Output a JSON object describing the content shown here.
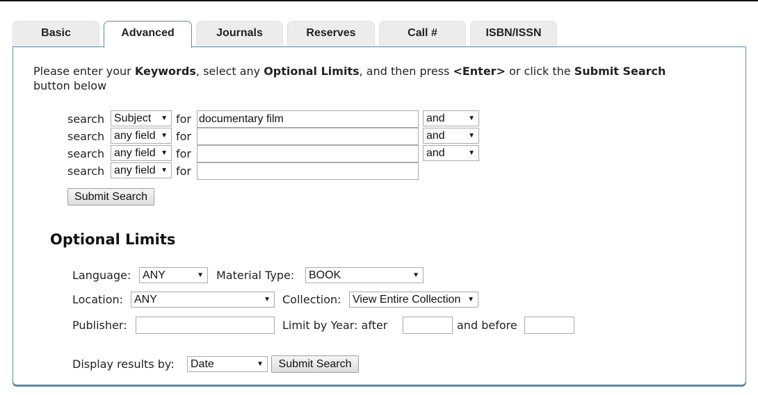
{
  "tabs": [
    {
      "label": "Basic"
    },
    {
      "label": "Advanced"
    },
    {
      "label": "Journals"
    },
    {
      "label": "Reserves"
    },
    {
      "label": "Call #"
    },
    {
      "label": "ISBN/ISSN"
    }
  ],
  "active_tab": "Advanced",
  "intro": {
    "t1": "Please enter your ",
    "b1": "Keywords",
    "t2": ", select any ",
    "b2": "Optional Limits",
    "t3": ", and then press ",
    "b3": "<Enter>",
    "t4": " or click the ",
    "b4": "Submit Search",
    "t5": " button below"
  },
  "search_rows": [
    {
      "search_label": "search",
      "field": "Subject",
      "for_label": "for",
      "value": "documentary film",
      "bool": "and"
    },
    {
      "search_label": "search",
      "field": "any field",
      "for_label": "for",
      "value": "",
      "bool": "and"
    },
    {
      "search_label": "search",
      "field": "any field",
      "for_label": "for",
      "value": "",
      "bool": "and"
    },
    {
      "search_label": "search",
      "field": "any field",
      "for_label": "for",
      "value": ""
    }
  ],
  "submit_label": "Submit Search",
  "optional_limits": {
    "title": "Optional Limits",
    "language_label": "Language:",
    "language_value": "ANY",
    "material_label": "Material Type:",
    "material_value": "BOOK",
    "location_label": "Location:",
    "location_value": "ANY",
    "collection_label": "Collection:",
    "collection_value": "View Entire Collection",
    "publisher_label": "Publisher:",
    "publisher_value": "",
    "year_label": "Limit by Year: after",
    "year_after_value": "",
    "and_before_label": "and before",
    "year_before_value": ""
  },
  "display": {
    "label": "Display results by:",
    "value": "Date",
    "submit_label": "Submit Search"
  },
  "colors": {
    "panel_border": "#5d8aa0",
    "tab_bg": "#ececec"
  }
}
